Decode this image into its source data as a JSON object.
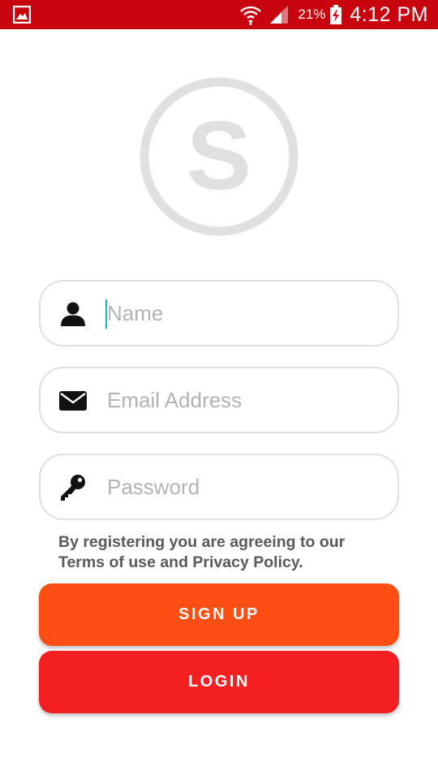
{
  "status_bar": {
    "battery_percent": "21%",
    "time": "4:12 PM",
    "background_color": "#c8040e",
    "icons": [
      "gallery-icon",
      "wifi-icon",
      "signal-icon",
      "battery-charging-icon"
    ]
  },
  "logo": {
    "letter": "S",
    "color": "#e0e0e0"
  },
  "form": {
    "name": {
      "placeholder": "Name",
      "value": "",
      "icon": "user-icon"
    },
    "email": {
      "placeholder": "Email Address",
      "value": "",
      "icon": "envelope-icon"
    },
    "password": {
      "placeholder": "Password",
      "value": "",
      "icon": "key-icon"
    }
  },
  "terms_text": "By registering you are agreeing to our Terms of use and Privacy Policy.",
  "buttons": {
    "signup_label": "SIGN UP",
    "signup_color": "#fe4e14",
    "login_label": "LOGIN",
    "login_color": "#f41f20"
  }
}
